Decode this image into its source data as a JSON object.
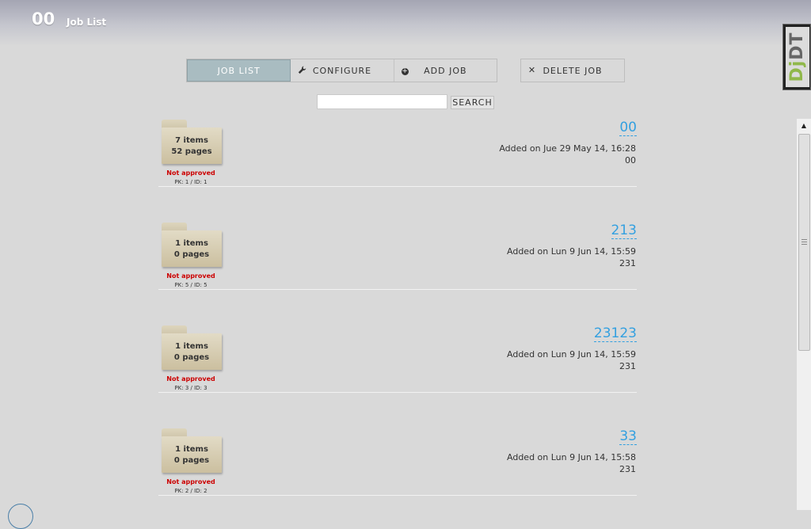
{
  "header": {
    "code": "00",
    "title": "Job List"
  },
  "debug_toolbar": {
    "label_dj": "Dj",
    "label_dt": "DT"
  },
  "nav": {
    "job_list": "JOB LIST",
    "configure": "CONFIGURE",
    "add_job": "ADD JOB",
    "delete_job": "DELETE JOB"
  },
  "search": {
    "value": "",
    "button": "SEARCH"
  },
  "jobs": [
    {
      "items": "7 items",
      "pages": "52 pages",
      "status": "Not approved",
      "pk": "PK: 1 / ID: 1",
      "name": "00",
      "added": "Added on Jue 29 May 14, 16:28",
      "desc": "00"
    },
    {
      "items": "1 items",
      "pages": "0 pages",
      "status": "Not approved",
      "pk": "PK: 5 / ID: 5",
      "name": "213",
      "added": "Added on Lun 9 Jun 14, 15:59",
      "desc": "231"
    },
    {
      "items": "1 items",
      "pages": "0 pages",
      "status": "Not approved",
      "pk": "PK: 3 / ID: 3",
      "name": "23123",
      "added": "Added on Lun 9 Jun 14, 15:59",
      "desc": "231"
    },
    {
      "items": "1 items",
      "pages": "0 pages",
      "status": "Not approved",
      "pk": "PK: 2 / ID: 2",
      "name": "33",
      "added": "Added on Lun 9 Jun 14, 15:58",
      "desc": "231"
    }
  ],
  "colors": {
    "link": "#33a0e0",
    "not_approved": "#cc0000",
    "active_tab": "#a9bcc1"
  },
  "icons": {
    "configure": "wrench-icon",
    "add_job": "plus-circle-icon",
    "delete_job": "close-icon",
    "scroll_up": "arrow-up-icon"
  }
}
